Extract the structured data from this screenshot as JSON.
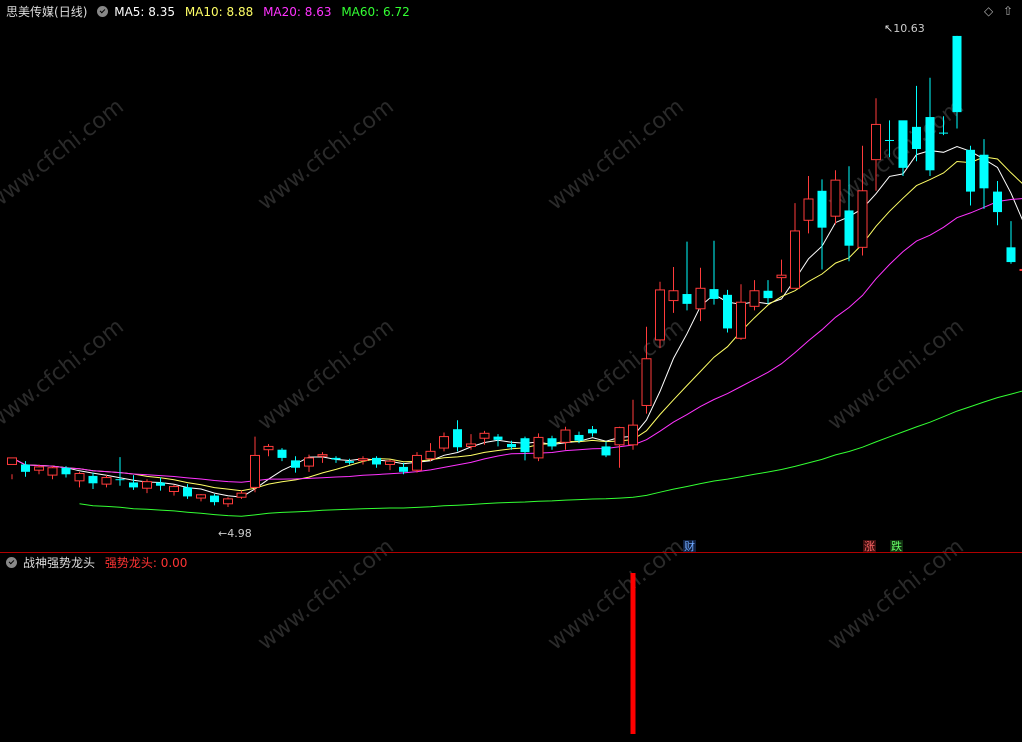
{
  "header": {
    "stock_name": "思美传媒",
    "period": "(日线)",
    "ma5": "MA5: 8.35",
    "ma10": "MA10: 8.88",
    "ma20": "MA20: 8.63",
    "ma60": "MA60: 6.72"
  },
  "sub_header": {
    "indicator_name": "战神强势龙头",
    "indicator_value": "强势龙头: 0.00"
  },
  "markers": {
    "high_label": "10.63",
    "low_label": "4.98",
    "cai_tag": "财",
    "zhang_tag": "涨",
    "die_tag": "跌"
  },
  "watermark": "www.cfchi.com",
  "colors": {
    "up": "#ff3b3b",
    "down": "#00ffff",
    "ma5": "#ffffff",
    "ma10": "#ffff66",
    "ma20": "#ff33ff",
    "ma60": "#33ff33",
    "signal": "#ff0000"
  },
  "chart_data": {
    "type": "candlestick",
    "ylim": [
      4.6,
      10.8
    ],
    "candles": [
      [
        5.4,
        5.48,
        5.22,
        5.28
      ],
      [
        5.4,
        5.31,
        5.25,
        5.44
      ],
      [
        5.33,
        5.37,
        5.28,
        5.4
      ],
      [
        5.27,
        5.36,
        5.22,
        5.38
      ],
      [
        5.36,
        5.28,
        5.24,
        5.38
      ],
      [
        5.2,
        5.29,
        5.12,
        5.31
      ],
      [
        5.26,
        5.17,
        5.1,
        5.3
      ],
      [
        5.16,
        5.24,
        5.12,
        5.27
      ],
      [
        5.22,
        5.21,
        5.14,
        5.49
      ],
      [
        5.18,
        5.12,
        5.09,
        5.27
      ],
      [
        5.11,
        5.19,
        5.05,
        5.22
      ],
      [
        5.18,
        5.14,
        5.08,
        5.24
      ],
      [
        5.07,
        5.13,
        5.02,
        5.15
      ],
      [
        5.12,
        5.01,
        4.98,
        5.16
      ],
      [
        4.99,
        5.03,
        4.95,
        5.04
      ],
      [
        5.02,
        4.94,
        4.9,
        5.04
      ],
      [
        4.92,
        4.98,
        4.88,
        5.0
      ],
      [
        5.0,
        5.05,
        4.98,
        5.08
      ],
      [
        5.12,
        5.51,
        5.06,
        5.74
      ],
      [
        5.58,
        5.62,
        5.5,
        5.65
      ],
      [
        5.58,
        5.48,
        5.44,
        5.6
      ],
      [
        5.45,
        5.36,
        5.3,
        5.5
      ],
      [
        5.38,
        5.48,
        5.31,
        5.52
      ],
      [
        5.5,
        5.52,
        5.42,
        5.55
      ],
      [
        5.48,
        5.46,
        5.42,
        5.5
      ],
      [
        5.44,
        5.42,
        5.4,
        5.47
      ],
      [
        5.45,
        5.47,
        5.4,
        5.5
      ],
      [
        5.48,
        5.4,
        5.36,
        5.5
      ],
      [
        5.4,
        5.44,
        5.33,
        5.46
      ],
      [
        5.37,
        5.31,
        5.28,
        5.42
      ],
      [
        5.33,
        5.51,
        5.3,
        5.55
      ],
      [
        5.47,
        5.56,
        5.44,
        5.66
      ],
      [
        5.6,
        5.74,
        5.56,
        5.79
      ],
      [
        5.83,
        5.61,
        5.56,
        5.94
      ],
      [
        5.62,
        5.65,
        5.58,
        5.77
      ],
      [
        5.72,
        5.78,
        5.64,
        5.81
      ],
      [
        5.74,
        5.7,
        5.62,
        5.77
      ],
      [
        5.65,
        5.61,
        5.58,
        5.69
      ],
      [
        5.72,
        5.55,
        5.45,
        5.74
      ],
      [
        5.48,
        5.73,
        5.44,
        5.78
      ],
      [
        5.72,
        5.62,
        5.58,
        5.75
      ],
      [
        5.67,
        5.82,
        5.58,
        5.86
      ],
      [
        5.76,
        5.69,
        5.66,
        5.8
      ],
      [
        5.83,
        5.78,
        5.74,
        5.87
      ],
      [
        5.62,
        5.51,
        5.49,
        5.68
      ],
      [
        5.64,
        5.85,
        5.36,
        5.86
      ],
      [
        5.64,
        5.88,
        5.58,
        6.19
      ],
      [
        6.12,
        6.69,
        6.02,
        7.08
      ],
      [
        6.92,
        7.53,
        6.82,
        7.63
      ],
      [
        7.4,
        7.52,
        7.25,
        7.81
      ],
      [
        7.48,
        7.36,
        7.28,
        8.12
      ],
      [
        7.3,
        7.55,
        7.15,
        7.8
      ],
      [
        7.54,
        7.42,
        7.35,
        8.13
      ],
      [
        7.47,
        7.06,
        7.01,
        7.53
      ],
      [
        6.94,
        7.38,
        6.92,
        7.6
      ],
      [
        7.33,
        7.52,
        7.28,
        7.65
      ],
      [
        7.52,
        7.43,
        7.36,
        7.65
      ],
      [
        7.68,
        7.71,
        7.5,
        7.9
      ],
      [
        7.55,
        8.25,
        7.62,
        8.59
      ],
      [
        8.38,
        8.64,
        8.22,
        8.92
      ],
      [
        8.74,
        8.29,
        7.78,
        8.88
      ],
      [
        8.43,
        8.87,
        8.33,
        8.99
      ],
      [
        8.5,
        8.07,
        7.88,
        9.04
      ],
      [
        8.05,
        8.74,
        7.95,
        9.29
      ],
      [
        9.12,
        9.55,
        8.74,
        9.87
      ],
      [
        9.36,
        9.35,
        9.15,
        9.6
      ],
      [
        9.6,
        9.02,
        8.92,
        9.56
      ],
      [
        9.52,
        9.25,
        9.1,
        10.02
      ],
      [
        9.64,
        8.99,
        8.92,
        10.12
      ],
      [
        9.45,
        9.44,
        9.42,
        9.65
      ],
      [
        10.63,
        9.7,
        9.5,
        10.63
      ],
      [
        9.24,
        8.73,
        8.56,
        9.29
      ],
      [
        9.18,
        8.77,
        8.52,
        9.37
      ],
      [
        8.73,
        8.48,
        8.32,
        8.86
      ],
      [
        8.05,
        7.87,
        7.85,
        8.37
      ],
      [
        7.78,
        7.78,
        7.7,
        8.18
      ],
      [
        7.98,
        8.02,
        7.68,
        8.3
      ],
      [
        8.47,
        8.05,
        7.91,
        8.51
      ],
      [
        8.33,
        8.38,
        8.08,
        8.62
      ]
    ],
    "signal": {
      "label": "强势龙头",
      "candle_index": 46,
      "value": 1
    }
  }
}
